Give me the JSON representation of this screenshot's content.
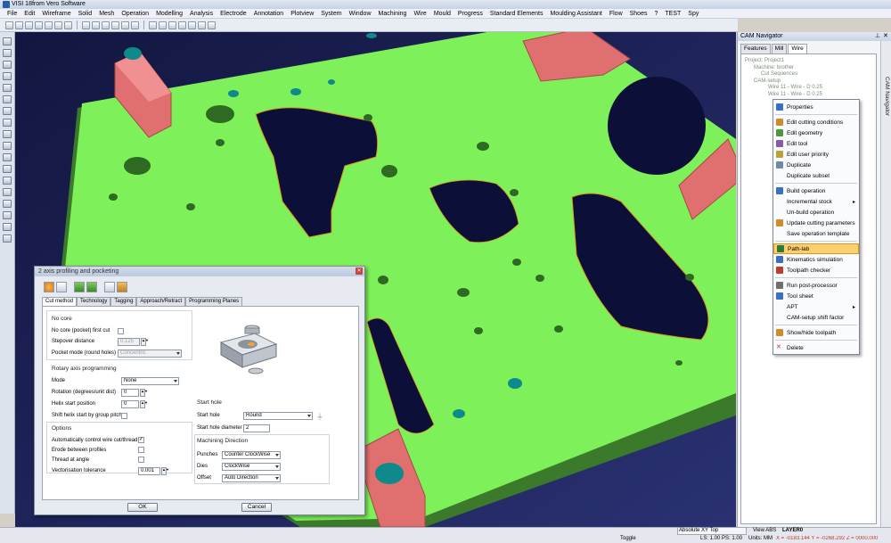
{
  "window": {
    "title": "VISI 18from Vero Software"
  },
  "menu": [
    "File",
    "Edit",
    "Wireframe",
    "Solid",
    "Mesh",
    "Operation",
    "Modelling",
    "Analysis",
    "Electrode",
    "Annotation",
    "Plotview",
    "System",
    "Window",
    "Machining",
    "Wire",
    "Mould",
    "Progress",
    "Standard Elements",
    "Moulding Assistant",
    "Flow",
    "Shoes",
    "?",
    "TEST",
    "Spy"
  ],
  "cam_navigator": {
    "title": "CAM Navigator",
    "tabs": [
      "Features",
      "Mill",
      "Wire"
    ],
    "active_tab": "Wire",
    "side_label": "CAM Navigator",
    "tree": [
      "Project: Project1",
      "Machine: brother",
      "Cut Sequences",
      "CAM-setup",
      "Wire 11 - Wire - D 0.25",
      "Wire 11 - Wire - D 0.25"
    ]
  },
  "context_menu": {
    "items": [
      {
        "label": "Properties",
        "icon_color": "#3a6fc4"
      },
      {
        "sep": true
      },
      {
        "label": "Edit cutting conditions",
        "icon_color": "#d18a2a"
      },
      {
        "label": "Edit geometry",
        "icon_color": "#4a9a3c"
      },
      {
        "label": "Edit tool",
        "icon_color": "#8a5aa8"
      },
      {
        "label": "Edit user priority",
        "icon_color": "#c0a030"
      },
      {
        "label": "Duplicate",
        "icon_color": "#6e8aa8"
      },
      {
        "label": "Duplicate subset",
        "icon_color": "none"
      },
      {
        "sep": true
      },
      {
        "label": "Build operation",
        "icon_color": "#3a6fc4"
      },
      {
        "label": "Incremental stock",
        "icon_color": "none",
        "submenu": true
      },
      {
        "label": "Un-build operation",
        "icon_color": "none"
      },
      {
        "label": "Update cutting parameters",
        "icon_color": "#d18a2a"
      },
      {
        "label": "Save operation template",
        "icon_color": "none"
      },
      {
        "sep": true
      },
      {
        "label": "Path-lab",
        "icon_color": "#2e7a3a",
        "highlighted": true
      },
      {
        "label": "Kinematics simulation",
        "icon_color": "#3a6fc4"
      },
      {
        "label": "Toolpath checker",
        "icon_color": "#c03a2b"
      },
      {
        "sep": true
      },
      {
        "label": "Run post-processor",
        "icon_color": "#6e6e6e"
      },
      {
        "label": "Tool sheet",
        "icon_color": "#3a6fc4"
      },
      {
        "label": "APT",
        "icon_color": "none",
        "submenu": true
      },
      {
        "label": "CAM-setup shift factor",
        "icon_color": "none"
      },
      {
        "sep": true
      },
      {
        "label": "Show/hide toolpath",
        "icon_color": "#d18a2a"
      },
      {
        "sep": true
      },
      {
        "label": "Delete",
        "icon_color": "#c03a2b",
        "icon": "x-icon"
      }
    ]
  },
  "dialog": {
    "title": "2 axis profiling and pocketing",
    "tabs": [
      "Cut method",
      "Technology",
      "Tagging",
      "Approach/Retract",
      "Programming Planes"
    ],
    "active_tab": "Cut method",
    "no_core": {
      "heading": "No core",
      "no_core_first_cut_label": "No core (pocket) first cut",
      "stepover_label": "Stepover distance",
      "stepover_value": "0.125",
      "pocket_mode_label": "Pocket mode (round holes)",
      "pocket_mode_value": "Concentric"
    },
    "rotary": {
      "heading": "Rotary axis programming",
      "mode_label": "Mode",
      "mode_value": "None",
      "rotation_label": "Rotation (degrees/unit dist)",
      "rotation_value": "0",
      "helix_label": "Helix start position",
      "helix_value": "0",
      "shift_label": "Shift helix start by group pitch"
    },
    "options": {
      "heading": "Options",
      "auto_control_label": "Automatically control wire cut/thread",
      "auto_control_checked": "✓",
      "erode_label": "Erode between profiles",
      "thread_label": "Thread at angle",
      "vect_label": "Vectorisation tolerance",
      "vect_value": "0.001"
    },
    "start_hole": {
      "heading": "Start hole",
      "start_hole_label": "Start hole",
      "start_hole_value": "Round",
      "diameter_label": "Start hole diameter",
      "diameter_value": "2"
    },
    "machining_direction": {
      "heading": "Machining Direction",
      "punches_label": "Punches",
      "punches_value": "Counter ClockWise",
      "dies_label": "Dies",
      "dies_value": "ClockWise",
      "offset_label": "Offset",
      "offset_value": "Auto Direction"
    },
    "ok_label": "OK",
    "cancel_label": "Cancel"
  },
  "status_bar": {
    "toggle": "Toggle",
    "view_name": "Absolute XY Top",
    "view_abs": "View ABS",
    "layer": "LAYER0",
    "ls_ps": "LS: 1.00  PS: 1.00",
    "units": "Units: MM",
    "coords": "X = -0183.144  Y = -0268.292  Z = 0000.000"
  },
  "colors": {
    "plate": "#7ef05a",
    "plate_edge": "#4ca03a",
    "block": "#e07070",
    "cyan": "#0e8a8a",
    "background": "#1a1f4e",
    "highlight": "#ffcf6e"
  }
}
